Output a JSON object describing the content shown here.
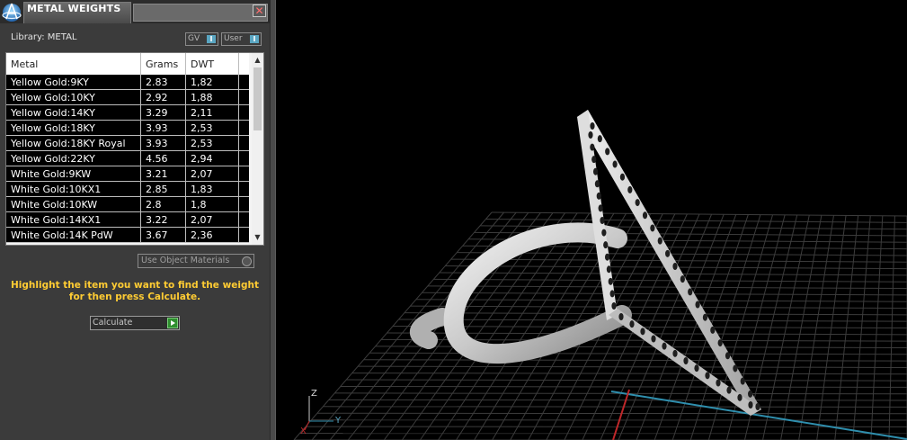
{
  "window": {
    "title": "METAL WEIGHTS",
    "close_glyph": "✕"
  },
  "library": {
    "label": "Library: METAL",
    "gv_label": "GV",
    "gv_indicator": "I",
    "user_label": "User",
    "user_indicator": "I"
  },
  "table": {
    "headers": {
      "metal": "Metal",
      "grams": "Grams",
      "dwt": "DWT"
    },
    "rows": [
      {
        "metal": "Yellow Gold:9KY",
        "grams": "2.83",
        "dwt": "1,82"
      },
      {
        "metal": "Yellow Gold:10KY",
        "grams": "2.92",
        "dwt": "1,88"
      },
      {
        "metal": "Yellow Gold:14KY",
        "grams": "3.29",
        "dwt": "2,11"
      },
      {
        "metal": "Yellow Gold:18KY",
        "grams": "3.93",
        "dwt": "2,53"
      },
      {
        "metal": "Yellow Gold:18KY Royal",
        "grams": "3.93",
        "dwt": "2,53"
      },
      {
        "metal": "Yellow Gold:22KY",
        "grams": "4.56",
        "dwt": "2,94"
      },
      {
        "metal": "White Gold:9KW",
        "grams": "3.21",
        "dwt": "2,07"
      },
      {
        "metal": "White Gold:10KX1",
        "grams": "2.85",
        "dwt": "1,83"
      },
      {
        "metal": "White Gold:10KW",
        "grams": "2.8",
        "dwt": "1,8"
      },
      {
        "metal": "White Gold:14KX1",
        "grams": "3.22",
        "dwt": "2,07"
      },
      {
        "metal": "White Gold:14K PdW",
        "grams": "3.67",
        "dwt": "2,36"
      }
    ],
    "scroll_up_glyph": "▲",
    "scroll_down_glyph": "▼"
  },
  "options": {
    "use_object_materials": "Use Object Materials"
  },
  "hint": {
    "line1": "Highlight the item you want to find the weight",
    "line2": "for then press Calculate."
  },
  "actions": {
    "calculate": "Calculate"
  },
  "viewport": {
    "axis_z": "Z",
    "axis_y": "Y",
    "axis_x": "X"
  },
  "colors": {
    "panel_bg": "#3b3b3b",
    "hint_text": "#ffcc33",
    "accent_blue": "#5aa6c2",
    "grid_line": "#3c3c3c",
    "axis_x": "#c0282a",
    "axis_y": "#2f8fae"
  }
}
